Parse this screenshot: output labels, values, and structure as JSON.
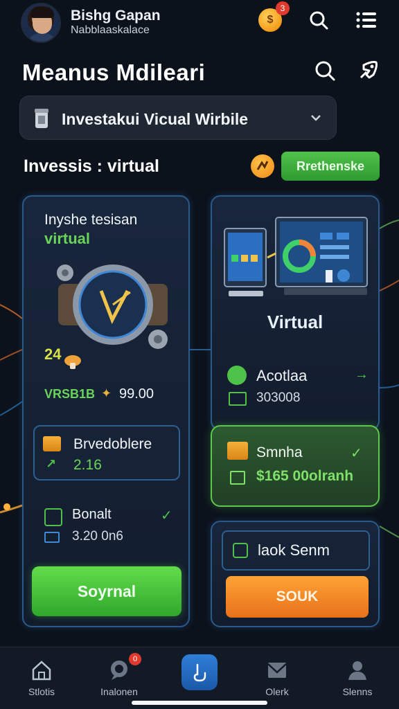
{
  "header": {
    "user_name": "Bishg Gapan",
    "user_sub": "Nabblaaskalace",
    "notif_count": "3",
    "coin_symbol": "$",
    "icons": [
      "search-icon",
      "menu-icon"
    ]
  },
  "page": {
    "title": "Meanus Mdileari",
    "icons": [
      "search-icon",
      "rocket-icon"
    ]
  },
  "selector": {
    "label": "Investakui Vicual Wirbile"
  },
  "section": {
    "title": "Invessis : virtual",
    "pill_label": "Rrethenske"
  },
  "left_card": {
    "title": "Inyshe tesisan",
    "subtitle": "virtual",
    "number": "24",
    "code": "VRSB1B",
    "price": "99.00",
    "box1_title": "Brvedoblere",
    "box1_value": "2.16",
    "bonus_label": "Bonalt",
    "bonus_value": "3.20 0n6",
    "button_label": "Soyrnal"
  },
  "right_card": {
    "title": "Virtual",
    "row1_label": "Acotlaa",
    "row1_value": "303008"
  },
  "green_card": {
    "title": "Smnha",
    "value": "$165 00olranh"
  },
  "right_bottom": {
    "lock_label": "laok Senm",
    "button_label": "SOUK"
  },
  "bottom_nav": {
    "items": [
      {
        "label": "Stlotis",
        "icon": "home-icon"
      },
      {
        "label": "Inalonen",
        "icon": "chat-icon",
        "badge": "0"
      },
      {
        "label": "",
        "icon": "touch-icon"
      },
      {
        "label": "Olerk",
        "icon": "mail-icon"
      },
      {
        "label": "Slenns",
        "icon": "user-icon"
      }
    ]
  },
  "colors": {
    "background": "#0c121c",
    "accent_green": "#4fc24a",
    "accent_orange": "#f0851c",
    "card_border": "#2b5a8a",
    "badge_red": "#e03a2e"
  }
}
